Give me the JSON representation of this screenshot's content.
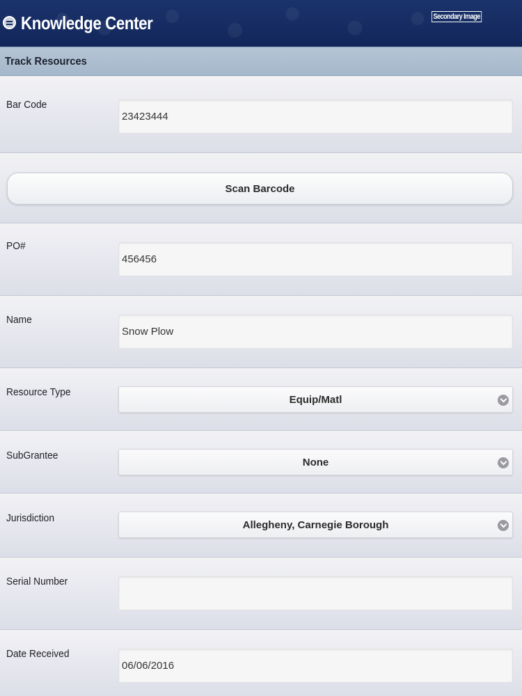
{
  "header": {
    "title": "Knowledge Center",
    "secondary_link": "Secondary Image"
  },
  "section": {
    "title": "Track Resources"
  },
  "form": {
    "bar_code": {
      "label": "Bar Code",
      "value": "23423444"
    },
    "scan_button": "Scan Barcode",
    "po_number": {
      "label": "PO#",
      "value": "456456"
    },
    "name": {
      "label": "Name",
      "value": "Snow Plow"
    },
    "resource_type": {
      "label": "Resource Type",
      "value": "Equip/Matl"
    },
    "subgrantee": {
      "label": "SubGrantee",
      "value": "None"
    },
    "jurisdiction": {
      "label": "Jurisdiction",
      "value": "Allegheny, Carnegie Borough"
    },
    "serial_number": {
      "label": "Serial Number",
      "value": ""
    },
    "date_received": {
      "label": "Date Received",
      "value": "06/06/2016"
    }
  }
}
